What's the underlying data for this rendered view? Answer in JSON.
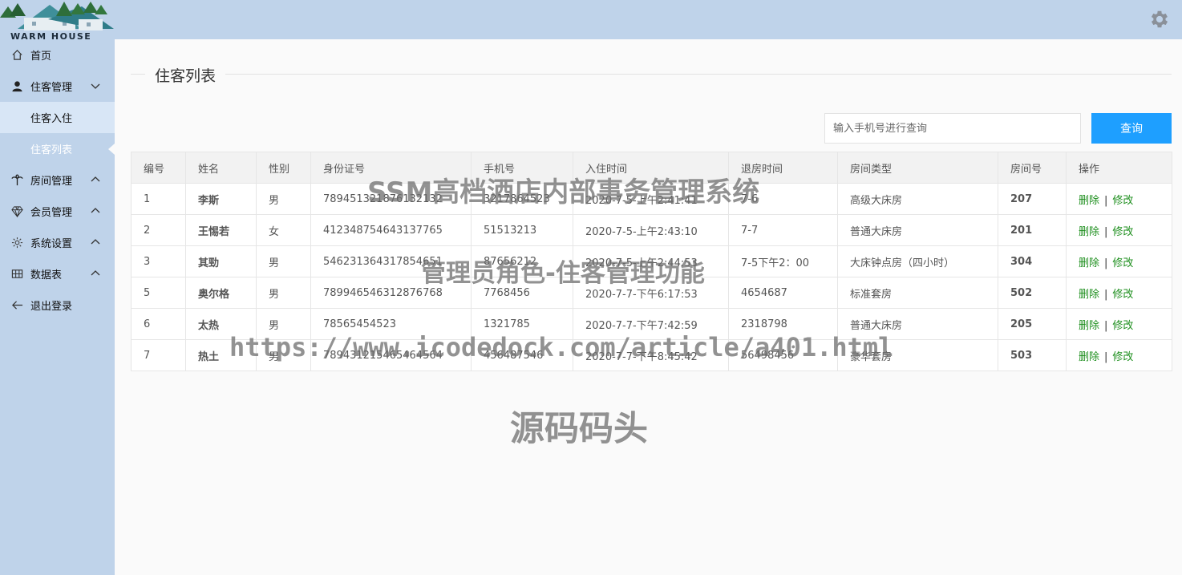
{
  "app": {
    "logo_text": "WARM HOUSE"
  },
  "sidebar": {
    "items": [
      {
        "label": "首页"
      },
      {
        "label": "住客管理"
      },
      {
        "label": "房间管理"
      },
      {
        "label": "会员管理"
      },
      {
        "label": "系统设置"
      },
      {
        "label": "数据表"
      },
      {
        "label": "退出登录"
      }
    ],
    "sub_items": [
      {
        "label": "住客入住"
      },
      {
        "label": "住客列表"
      }
    ]
  },
  "page": {
    "title": "住客列表"
  },
  "search": {
    "placeholder": "输入手机号进行查询",
    "value": "",
    "button_label": "查询"
  },
  "table": {
    "headers": [
      "编号",
      "姓名",
      "性别",
      "身份证号",
      "手机号",
      "入住时间",
      "退房时间",
      "房间类型",
      "房间号",
      "操作"
    ],
    "delete_label": "删除",
    "separator": "|",
    "edit_label": "修改",
    "rows": [
      {
        "id": "1",
        "name": "李斯",
        "gender": "男",
        "id_card": "789451321876132132",
        "phone": "3217864523",
        "checkin": "2020-7-5-上午2:41:41",
        "checkout": "7-6",
        "room_type": "高级大床房",
        "room_no": "207"
      },
      {
        "id": "2",
        "name": "王惕若",
        "gender": "女",
        "id_card": "412348754643137765",
        "phone": "51513213",
        "checkin": "2020-7-5-上午2:43:10",
        "checkout": "7-7",
        "room_type": "普通大床房",
        "room_no": "201"
      },
      {
        "id": "3",
        "name": "其勁",
        "gender": "男",
        "id_card": "546231364317854651",
        "phone": "87656212",
        "checkin": "2020-7-5-上午2:44:53",
        "checkout": "7-5下午2：00",
        "room_type": "大床钟点房（四小时）",
        "room_no": "304"
      },
      {
        "id": "5",
        "name": "奥尔格",
        "gender": "男",
        "id_card": "789946546312876768",
        "phone": "7768456",
        "checkin": "2020-7-7-下午6:17:53",
        "checkout": "4654687",
        "room_type": "标准套房",
        "room_no": "502"
      },
      {
        "id": "6",
        "name": "太热",
        "gender": "男",
        "id_card": "78565454523",
        "phone": "1321785",
        "checkin": "2020-7-7-下午7:42:59",
        "checkout": "2318798",
        "room_type": "普通大床房",
        "room_no": "205"
      },
      {
        "id": "7",
        "name": "热土",
        "gender": "男",
        "id_card": "789431215465464564",
        "phone": "456487546",
        "checkin": "2020-7-7-下午8:45:42",
        "checkout": "56498456",
        "room_type": "豪华套房",
        "room_no": "503"
      }
    ]
  },
  "watermark": {
    "line1": "SSM高档酒店内部事务管理系统",
    "line2": "管理员角色-住客管理功能",
    "line3": "https://www.icodedock.com/article/a401.html",
    "line4": "源码码头"
  },
  "colors": {
    "sidebar_bg": "#bfd3ea",
    "primary_button": "#1e9fff",
    "action_link": "#1e8f1e"
  }
}
